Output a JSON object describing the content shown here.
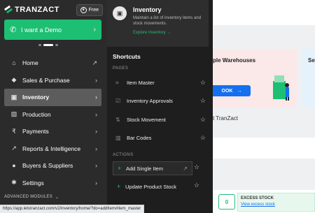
{
  "sidebar": {
    "logo_text": "TRANZACT",
    "free_label": "Free",
    "demo_label": "I want a Demo",
    "nav": [
      {
        "label": "Home",
        "icon": "home-icon",
        "glyph": "⌂",
        "arrow": "↗"
      },
      {
        "label": "Sales & Purchase",
        "icon": "tag-icon",
        "glyph": "◆",
        "arrow": "›"
      },
      {
        "label": "Inventory",
        "icon": "inventory-icon",
        "glyph": "▣",
        "arrow": "›"
      },
      {
        "label": "Production",
        "icon": "production-icon",
        "glyph": "▨",
        "arrow": "›"
      },
      {
        "label": "Payments",
        "icon": "rupee-icon",
        "glyph": "₹",
        "arrow": "›"
      },
      {
        "label": "Reports & Intelligence",
        "icon": "chart-icon",
        "glyph": "↗",
        "arrow": "›"
      },
      {
        "label": "Buyers & Suppliers",
        "icon": "people-icon",
        "glyph": "●",
        "arrow": "›"
      },
      {
        "label": "Settings",
        "icon": "gear-icon",
        "glyph": "✱",
        "arrow": "›"
      }
    ],
    "advanced_label": "ADVANCED MODULES"
  },
  "panel": {
    "title": "Inventory",
    "description": "Maintain a list of inventory items and stock movements.",
    "explore_link": "Explore Inventory",
    "shortcuts_heading": "Shortcuts",
    "pages_heading": "PAGES",
    "pages": [
      {
        "label": "Item Master",
        "icon": "list-icon",
        "glyph": "≡"
      },
      {
        "label": "Inventory Approvals",
        "icon": "approval-icon",
        "glyph": "☑"
      },
      {
        "label": "Stock Movement",
        "icon": "stock-icon",
        "glyph": "⇅"
      },
      {
        "label": "Bar Codes",
        "icon": "barcode-icon",
        "glyph": "▥"
      }
    ],
    "actions_heading": "ACTIONS",
    "actions": [
      {
        "label": "Add Single Item",
        "icon": "plus-icon"
      },
      {
        "label": "Update Product Stock",
        "icon": "plus-icon"
      }
    ]
  },
  "main": {
    "card1_title": "ple Warehouses",
    "card1_button": "OOK",
    "card2_title": "Se",
    "tranzact_text": "t TranZact",
    "zero_value": "0",
    "excess_title": "EXCESS STOCK",
    "excess_link": "View excess stock"
  },
  "status_url": "https://app.letstranzact.com/v2/inventory/home/?do=addItem#item_master",
  "colors": {
    "accent": "#1dbf73",
    "sidebar_bg": "#2b2b2b",
    "link_blue": "#1570ef"
  }
}
